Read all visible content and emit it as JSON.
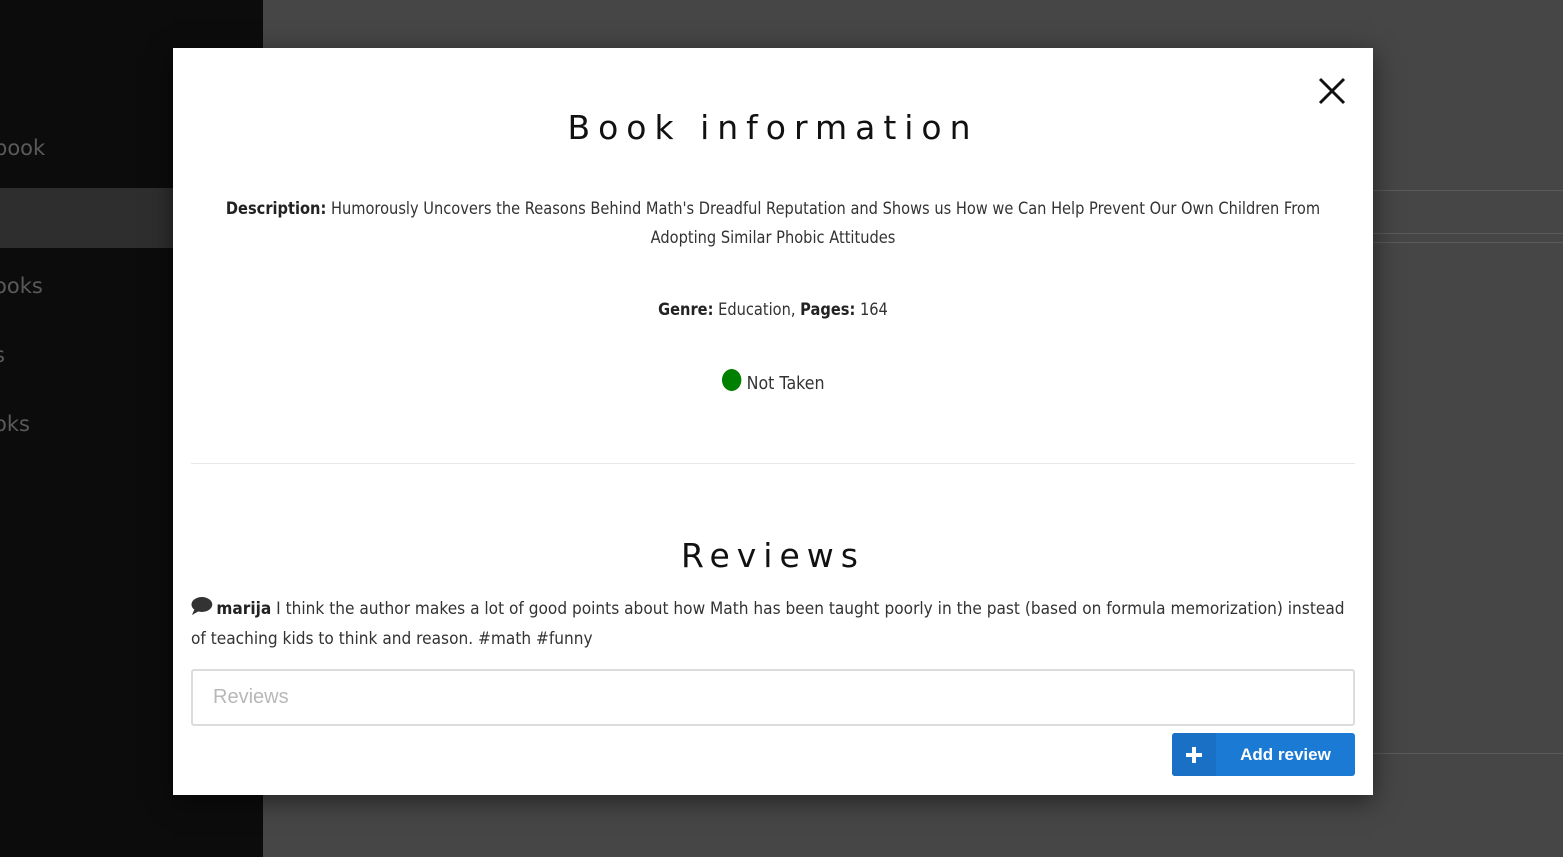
{
  "sidebar": {
    "items": [
      {
        "label": "book"
      },
      {
        "label": ""
      },
      {
        "label": "ooks"
      },
      {
        "label": "s"
      },
      {
        "label": "oks"
      }
    ]
  },
  "modal": {
    "title": "Book information",
    "description_label": "Description:",
    "description": "Humorously Uncovers the Reasons Behind Math's Dreadful Reputation and Shows us How we Can Help Prevent Our Own Children From Adopting Similar Phobic Attitudes",
    "genre_label": "Genre:",
    "genre": "Education",
    "separator": ",",
    "pages_label": "Pages:",
    "pages": "164",
    "status": {
      "text": "Not Taken",
      "color": "#008000"
    },
    "reviews_title": "Reviews",
    "reviews": [
      {
        "user": "marija",
        "text": "I think the author makes a lot of good points about how Math has been taught poorly in the past (based on formula memorization) instead of teaching kids to think and reason. #math #funny"
      }
    ],
    "review_input": {
      "value": "",
      "placeholder": "Reviews"
    },
    "add_button": {
      "icon": "plus-icon",
      "label": "Add review",
      "color": "#1a7ad4"
    },
    "close_icon": "close-icon"
  }
}
